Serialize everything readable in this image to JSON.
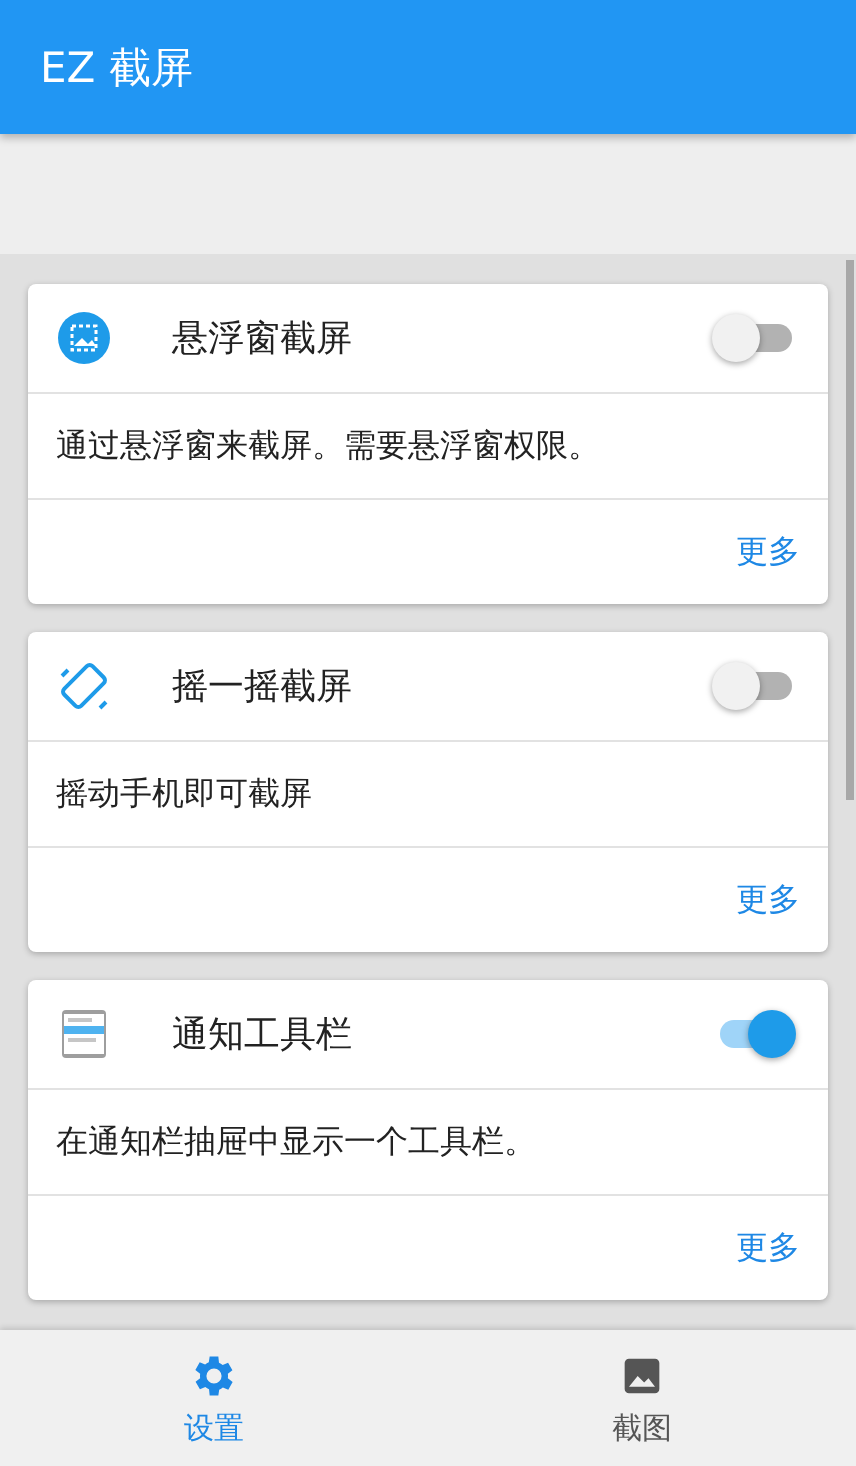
{
  "app_bar": {
    "title": "EZ 截屏"
  },
  "cards": [
    {
      "title": "悬浮窗截屏",
      "on": false,
      "description": "通过悬浮窗来截屏。需要悬浮窗权限。",
      "more": "更多"
    },
    {
      "title": "摇一摇截屏",
      "on": false,
      "description": "摇动手机即可截屏",
      "more": "更多"
    },
    {
      "title": "通知工具栏",
      "on": true,
      "description": "在通知栏抽屉中显示一个工具栏。",
      "more": "更多"
    }
  ],
  "bottom_nav": [
    {
      "label": "设置",
      "selected": true
    },
    {
      "label": "截图",
      "selected": false
    }
  ]
}
